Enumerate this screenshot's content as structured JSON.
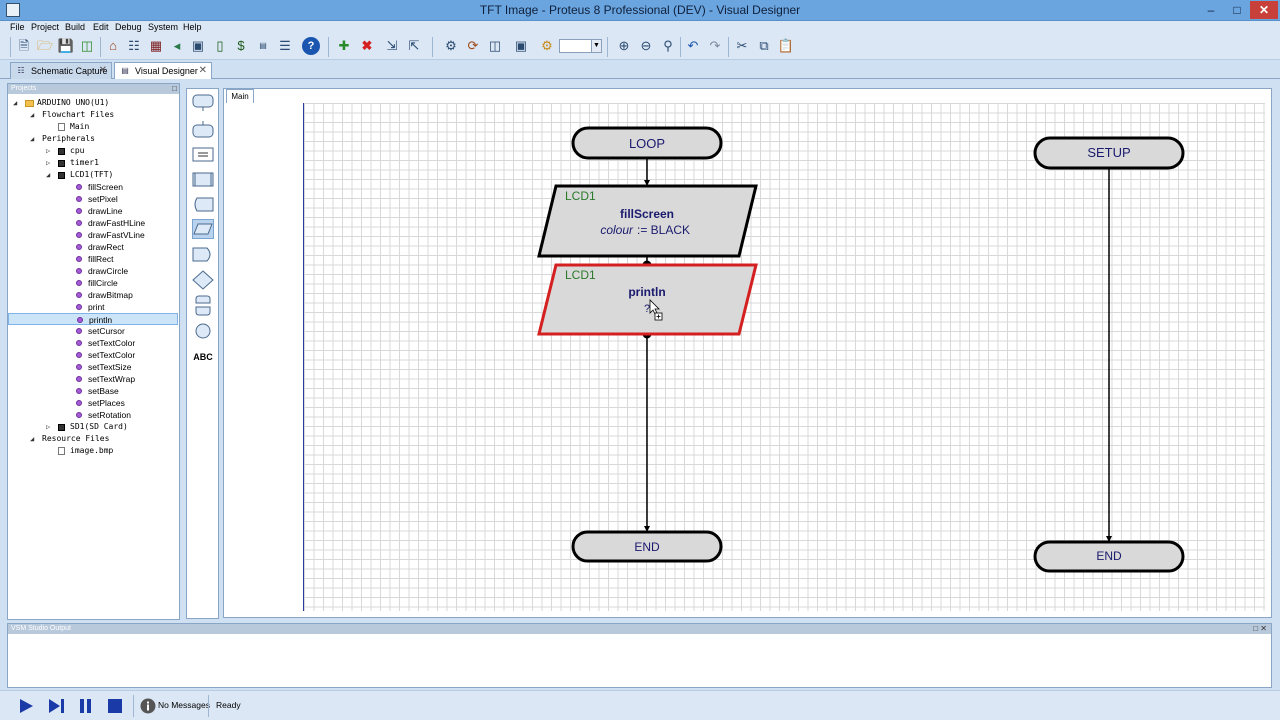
{
  "window": {
    "title": "TFT Image - Proteus 8 Professional (DEV) - Visual Designer"
  },
  "menu": [
    "File",
    "Project",
    "Build",
    "Edit",
    "Debug",
    "System",
    "Help"
  ],
  "toolbar": {
    "icons": [
      "new-file",
      "open-folder",
      "save",
      "import",
      "home",
      "schematic",
      "pcb",
      "3d-view",
      "gerber",
      "bill-of-materials",
      "design-explorer",
      "report",
      "help",
      "add",
      "delete",
      "export",
      "import-sheet",
      "build",
      "rebuild",
      "clean",
      "chip",
      "settings",
      "zoom-in",
      "zoom-out",
      "zoom-fit",
      "undo",
      "redo",
      "cut",
      "copy",
      "paste"
    ],
    "zoom_value": ""
  },
  "doc_tabs": [
    {
      "label": "Schematic Capture",
      "active": false
    },
    {
      "label": "Visual Designer",
      "active": true
    }
  ],
  "projects_panel": {
    "header": "Projects",
    "tree": [
      {
        "label": "ARDUINO UNO(U1)",
        "level": 0,
        "icon": "folder",
        "expander": "open",
        "mono": true
      },
      {
        "label": "Flowchart Files",
        "level": 1,
        "icon": "none",
        "expander": "open",
        "mono": true
      },
      {
        "label": "Main",
        "level": 2,
        "icon": "doc",
        "expander": "none",
        "mono": true
      },
      {
        "label": "Peripherals",
        "level": 1,
        "icon": "none",
        "expander": "open",
        "mono": true
      },
      {
        "label": "cpu",
        "level": 2,
        "icon": "chip",
        "expander": "closed",
        "mono": true
      },
      {
        "label": "timer1",
        "level": 2,
        "icon": "chip",
        "expander": "closed",
        "mono": true
      },
      {
        "label": "LCD1(TFT)",
        "level": 2,
        "icon": "chip",
        "expander": "open",
        "mono": true
      },
      {
        "label": "fillScreen",
        "level": 3,
        "icon": "method",
        "expander": "none"
      },
      {
        "label": "setPixel",
        "level": 3,
        "icon": "method",
        "expander": "none"
      },
      {
        "label": "drawLine",
        "level": 3,
        "icon": "method",
        "expander": "none"
      },
      {
        "label": "drawFastHLine",
        "level": 3,
        "icon": "method",
        "expander": "none"
      },
      {
        "label": "drawFastVLine",
        "level": 3,
        "icon": "method",
        "expander": "none"
      },
      {
        "label": "drawRect",
        "level": 3,
        "icon": "method",
        "expander": "none"
      },
      {
        "label": "fillRect",
        "level": 3,
        "icon": "method",
        "expander": "none"
      },
      {
        "label": "drawCircle",
        "level": 3,
        "icon": "method",
        "expander": "none"
      },
      {
        "label": "fillCircle",
        "level": 3,
        "icon": "method",
        "expander": "none"
      },
      {
        "label": "drawBitmap",
        "level": 3,
        "icon": "method",
        "expander": "none"
      },
      {
        "label": "print",
        "level": 3,
        "icon": "method",
        "expander": "none"
      },
      {
        "label": "println",
        "level": 3,
        "icon": "method",
        "expander": "none",
        "selected": true
      },
      {
        "label": "setCursor",
        "level": 3,
        "icon": "method",
        "expander": "none"
      },
      {
        "label": "setTextColor",
        "level": 3,
        "icon": "method",
        "expander": "none"
      },
      {
        "label": "setTextColor",
        "level": 3,
        "icon": "method",
        "expander": "none"
      },
      {
        "label": "setTextSize",
        "level": 3,
        "icon": "method",
        "expander": "none"
      },
      {
        "label": "setTextWrap",
        "level": 3,
        "icon": "method",
        "expander": "none"
      },
      {
        "label": "setBase",
        "level": 3,
        "icon": "method",
        "expander": "none"
      },
      {
        "label": "setPlaces",
        "level": 3,
        "icon": "method",
        "expander": "none"
      },
      {
        "label": "setRotation",
        "level": 3,
        "icon": "method",
        "expander": "none"
      },
      {
        "label": "SD1(SD Card)",
        "level": 2,
        "icon": "chip",
        "expander": "closed",
        "mono": true
      },
      {
        "label": "Resource Files",
        "level": 1,
        "icon": "none",
        "expander": "open",
        "mono": true
      },
      {
        "label": "image.bmp",
        "level": 2,
        "icon": "doc",
        "expander": "none",
        "mono": true
      }
    ]
  },
  "palette": {
    "tools": [
      "event-block",
      "end-block",
      "assignment-block",
      "subroutine-call",
      "storage-block",
      "io-block",
      "delay-block",
      "decision-block",
      "loop-block",
      "junction",
      "text-label"
    ],
    "text_label": "ABC"
  },
  "canvas": {
    "tab": "Main",
    "loop_label": "LOOP",
    "block1": {
      "device": "LCD1",
      "method": "fillScreen",
      "arg_name": "colour",
      "arg_op": ":= BLACK"
    },
    "block2": {
      "device": "LCD1",
      "method": "println",
      "arg": "?"
    },
    "end1_label": "END",
    "setup_label": "SETUP",
    "end2_label": "END",
    "colors": {
      "block_fill": "#d9d9d9",
      "selected_border": "#d42020",
      "device_text": "#2a7a2a",
      "body_text": "#1a1a6e"
    }
  },
  "output_panel": {
    "header": "VSM Studio Output"
  },
  "status": {
    "messages": "No Messages",
    "state": "Ready"
  }
}
